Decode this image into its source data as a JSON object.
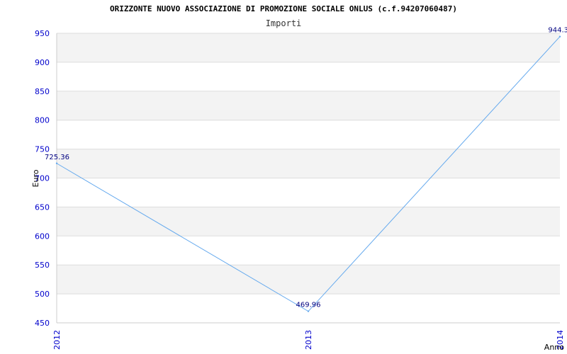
{
  "title": "ORIZZONTE NUOVO ASSOCIAZIONE DI PROMOZIONE SOCIALE ONLUS (c.f.94207060487)",
  "subtitle": "Importi",
  "chart_data": {
    "type": "line",
    "x": [
      "2012",
      "2013",
      "2014"
    ],
    "series": [
      {
        "values": [
          725.36,
          469.96,
          944.3
        ],
        "labels": [
          "725.36",
          "469.96",
          "944.3"
        ],
        "color": "#66aaee"
      }
    ],
    "xlabel": "Anno",
    "ylabel": "Euro",
    "ylim": [
      450,
      950
    ],
    "yticks": [
      450,
      500,
      550,
      600,
      650,
      700,
      750,
      800,
      850,
      900,
      950
    ],
    "grid": true,
    "band_color": "#f3f3f3",
    "tick_color": "#0000cc"
  }
}
